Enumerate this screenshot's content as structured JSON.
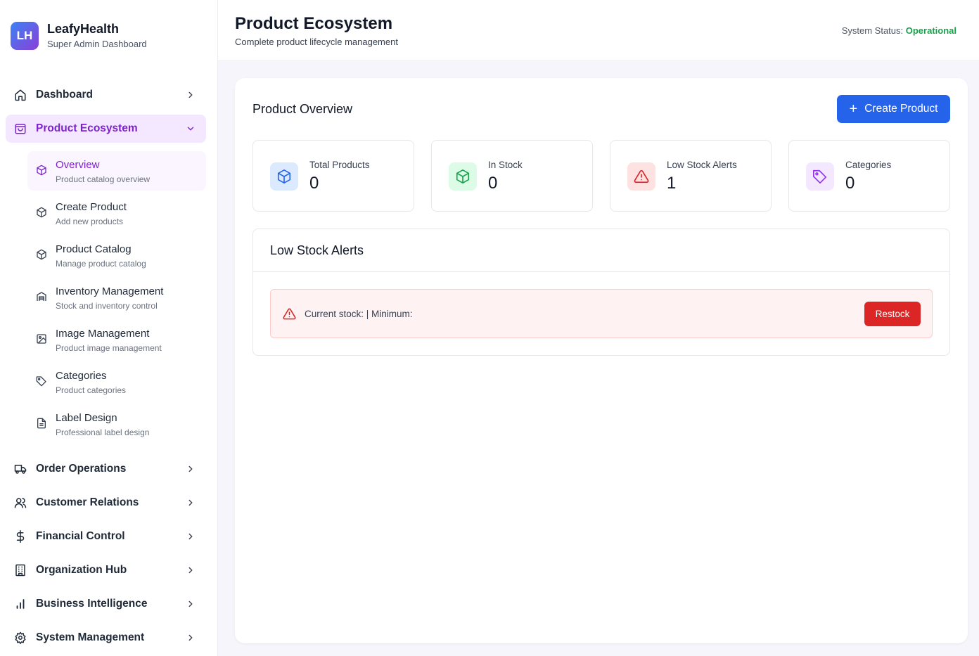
{
  "brand": {
    "logo_text": "LH",
    "title": "LeafyHealth",
    "subtitle": "Super Admin Dashboard"
  },
  "sidebar": {
    "dashboard": "Dashboard",
    "product_ecosystem": "Product Ecosystem",
    "sub_items": [
      {
        "label": "Overview",
        "desc": "Product catalog overview",
        "icon": "box-icon"
      },
      {
        "label": "Create Product",
        "desc": "Add new products",
        "icon": "box-icon"
      },
      {
        "label": "Product Catalog",
        "desc": "Manage product catalog",
        "icon": "box-icon"
      },
      {
        "label": "Inventory Management",
        "desc": "Stock and inventory control",
        "icon": "warehouse-icon"
      },
      {
        "label": "Image Management",
        "desc": "Product image management",
        "icon": "image-icon"
      },
      {
        "label": "Categories",
        "desc": "Product categories",
        "icon": "tag-icon"
      },
      {
        "label": "Label Design",
        "desc": "Professional label design",
        "icon": "file-text-icon"
      }
    ],
    "order_operations": "Order Operations",
    "customer_relations": "Customer Relations",
    "financial_control": "Financial Control",
    "organization_hub": "Organization Hub",
    "business_intelligence": "Business Intelligence",
    "system_management": "System Management"
  },
  "header": {
    "title": "Product Ecosystem",
    "subtitle": "Complete product lifecycle management",
    "status_label": "System Status:",
    "status_value": "Operational"
  },
  "overview": {
    "title": "Product Overview",
    "create_button": "Create Product",
    "stats": [
      {
        "label": "Total Products",
        "value": "0",
        "icon": "box-icon",
        "color": "#2563eb",
        "bg": "#dbeafe"
      },
      {
        "label": "In Stock",
        "value": "0",
        "icon": "box-icon",
        "color": "#16a34a",
        "bg": "#dcfce7"
      },
      {
        "label": "Low Stock Alerts",
        "value": "1",
        "icon": "alert-triangle-icon",
        "color": "#dc2626",
        "bg": "#fee2e2"
      },
      {
        "label": "Categories",
        "value": "0",
        "icon": "tag-icon",
        "color": "#9333ea",
        "bg": "#f3e8ff"
      }
    ]
  },
  "low_stock": {
    "title": "Low Stock Alerts",
    "alert_text": "Current stock:  | Minimum:",
    "restock_button": "Restock"
  },
  "colors": {
    "accent": "#7e22ce",
    "primary": "#2563eb",
    "danger": "#dc2626",
    "success": "#16a34a"
  }
}
